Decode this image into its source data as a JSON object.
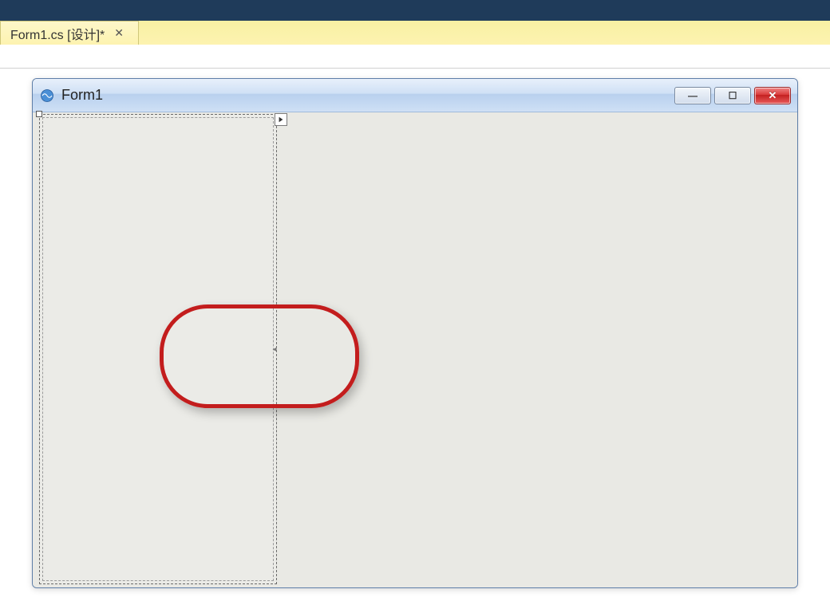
{
  "tab": {
    "label": "Form1.cs [设计]*",
    "close_glyph": "✕"
  },
  "form": {
    "title": "Form1",
    "buttons": {
      "minimize_glyph": "—",
      "maximize_glyph": "☐",
      "close_glyph": "✕"
    }
  },
  "colors": {
    "annotation": "#c31d1d",
    "titlebar_top": "#e8f0fb",
    "titlebar_bottom": "#cfe0f5"
  }
}
